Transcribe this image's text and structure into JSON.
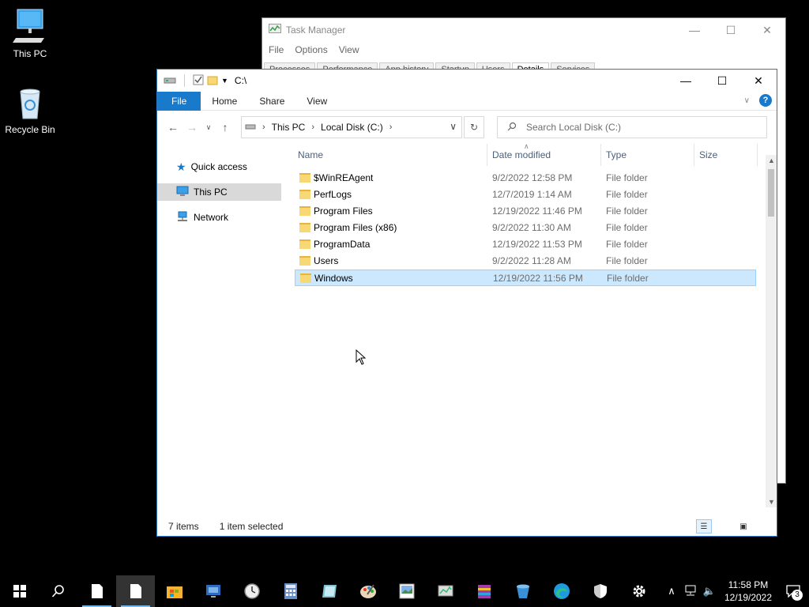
{
  "desktop": {
    "icons": [
      {
        "label": "This PC",
        "icon": "computer-icon"
      },
      {
        "label": "Recycle Bin",
        "icon": "recycle-bin-icon"
      }
    ]
  },
  "task_manager": {
    "title": "Task Manager",
    "menu": [
      "File",
      "Options",
      "View"
    ],
    "tabs": [
      "Processes",
      "Performance",
      "App history",
      "Startup",
      "Users",
      "Details",
      "Services"
    ],
    "selected_tab": "Details"
  },
  "explorer": {
    "title_path": "C:\\",
    "ribbon_tabs": [
      "File",
      "Home",
      "Share",
      "View"
    ],
    "breadcrumb": [
      "This PC",
      "Local Disk (C:)"
    ],
    "search_placeholder": "Search Local Disk (C:)",
    "nav": [
      "Quick access",
      "This PC",
      "Network"
    ],
    "nav_selected": "This PC",
    "columns": [
      "Name",
      "Date modified",
      "Type",
      "Size"
    ],
    "rows": [
      {
        "name": "$WinREAgent",
        "date": "9/2/2022 12:58 PM",
        "type": "File folder"
      },
      {
        "name": "PerfLogs",
        "date": "12/7/2019 1:14 AM",
        "type": "File folder"
      },
      {
        "name": "Program Files",
        "date": "12/19/2022 11:46 PM",
        "type": "File folder"
      },
      {
        "name": "Program Files (x86)",
        "date": "9/2/2022 11:30 AM",
        "type": "File folder"
      },
      {
        "name": "ProgramData",
        "date": "12/19/2022 11:53 PM",
        "type": "File folder"
      },
      {
        "name": "Users",
        "date": "9/2/2022 11:28 AM",
        "type": "File folder"
      },
      {
        "name": "Windows",
        "date": "12/19/2022 11:56 PM",
        "type": "File folder"
      }
    ],
    "selected_row": "Windows",
    "status": {
      "items": "7 items",
      "selected": "1 item selected"
    }
  },
  "taskbar": {
    "clock_time": "11:58 PM",
    "clock_date": "12/19/2022",
    "notification_count": "3"
  },
  "colors": {
    "accent": "#1979ca",
    "selection": "#cce8ff",
    "folder": "#f8d775"
  }
}
